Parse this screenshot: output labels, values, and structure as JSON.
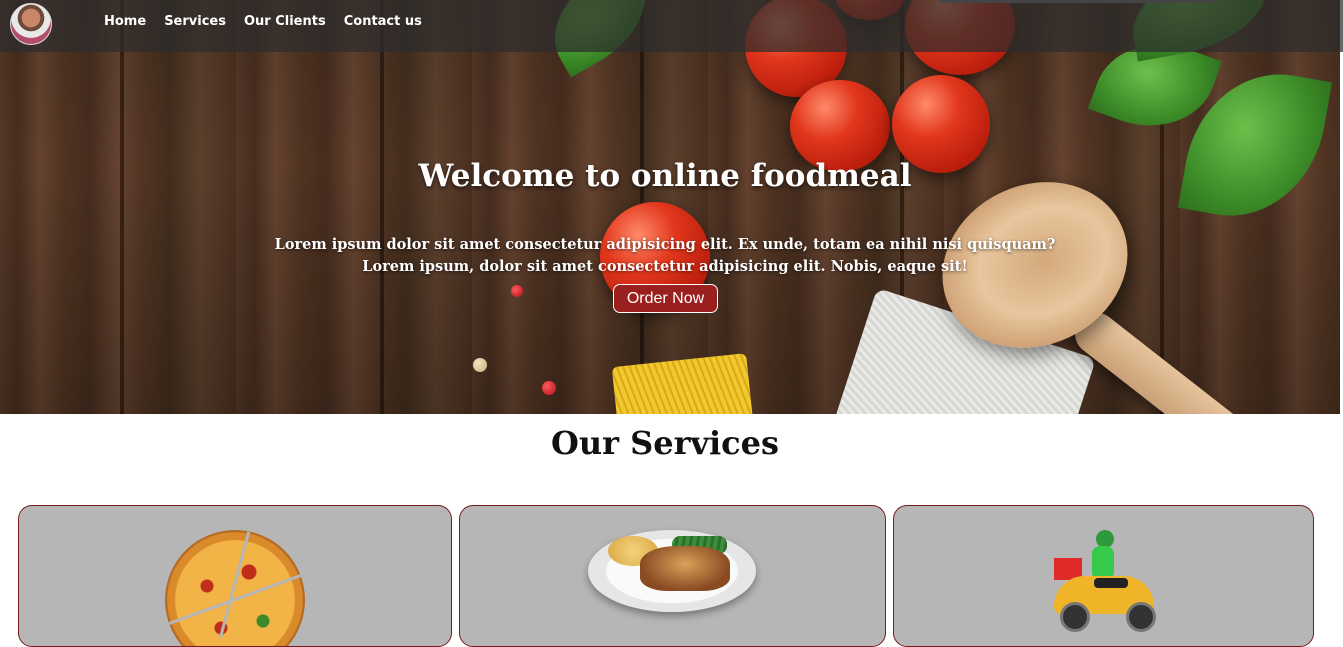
{
  "nav": {
    "avatar_icon": "profile-avatar",
    "links": [
      "Home",
      "Services",
      "Our Clients",
      "Contact us"
    ]
  },
  "hero": {
    "title": "Welcome to online foodmeal",
    "line1": "Lorem ipsum dolor sit amet consectetur adipisicing elit. Ex unde, totam ea nihil nisi quisquam?",
    "line2": "Lorem ipsum, dolor sit amet consectetur adipisicing elit. Nobis, eaque sit!",
    "button_label": "Order Now"
  },
  "services": {
    "title": "Our Services",
    "cards": [
      {
        "icon": "pizza-image"
      },
      {
        "icon": "meal-plate-image"
      },
      {
        "icon": "delivery-scooter-image"
      }
    ]
  },
  "colors": {
    "accent": "#9a1f1f",
    "navbar": "#2d2d2d",
    "card_bg": "#b6b6b6",
    "card_border": "#7a1a1a"
  }
}
